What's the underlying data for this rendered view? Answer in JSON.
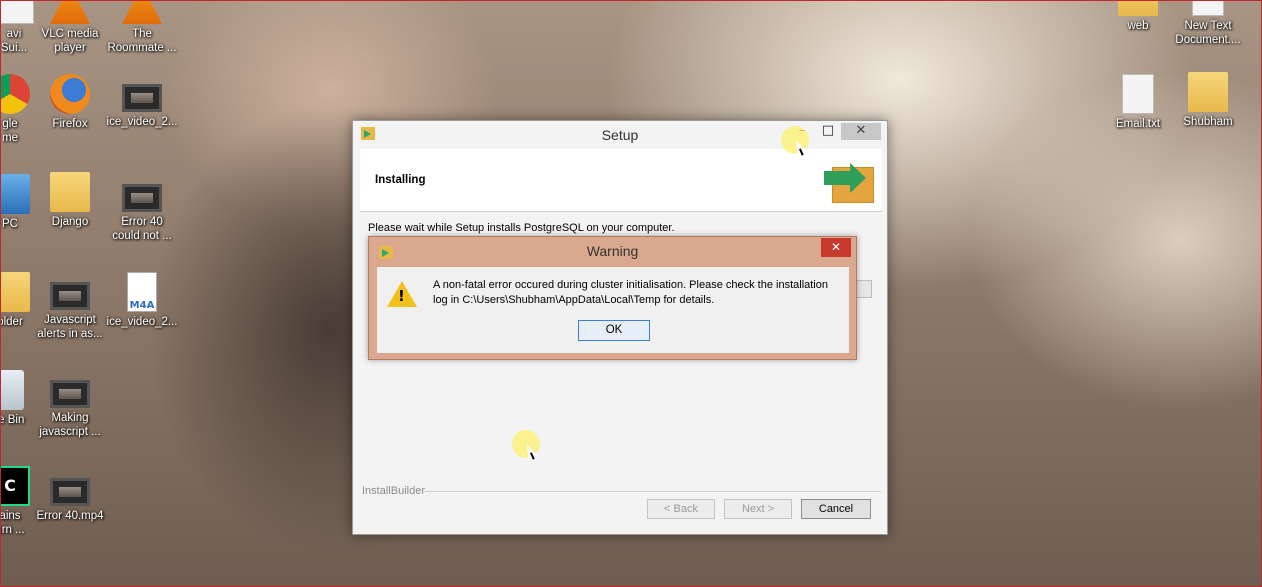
{
  "desktop": {
    "icons_left": [
      {
        "label": "avi\nSui...",
        "icon": "app-icon"
      },
      {
        "label": "VLC media\nplayer",
        "icon": "vlc-icon"
      },
      {
        "label": "The\nRoommate ...",
        "icon": "vlc-icon"
      },
      {
        "label": "gle\nme",
        "icon": "chrome-icon"
      },
      {
        "label": "Firefox",
        "icon": "firefox-icon"
      },
      {
        "label": "ice_video_2...",
        "icon": "video-file-icon"
      },
      {
        "label": "PC",
        "icon": "this-pc-icon"
      },
      {
        "label": "Django",
        "icon": "folder-icon"
      },
      {
        "label": "Error 40\ncould not ...",
        "icon": "video-file-icon"
      },
      {
        "label": "older",
        "icon": "folder-icon"
      },
      {
        "label": "Javascript\nalerts in as...",
        "icon": "video-file-icon"
      },
      {
        "label": "ice_video_2...",
        "icon": "m4a-file-icon"
      },
      {
        "label": "le Bin",
        "icon": "recycle-bin-icon"
      },
      {
        "label": "Making\njavascript ...",
        "icon": "video-file-icon"
      },
      {
        "label": "ains\nurn ...",
        "icon": "jetbrains-icon"
      },
      {
        "label": "Error 40.mp4",
        "icon": "video-file-icon"
      }
    ],
    "icons_right": [
      {
        "label": "web",
        "icon": "folder-icon"
      },
      {
        "label": "New Text\nDocument....",
        "icon": "text-file-icon"
      },
      {
        "label": "Email.txt",
        "icon": "text-file-icon"
      },
      {
        "label": "Shubham",
        "icon": "folder-icon"
      }
    ]
  },
  "setup": {
    "title": "Setup",
    "minimize": "–",
    "maximize": "□",
    "close": "✕",
    "header_title": "Installing",
    "status_text": "Please wait while Setup installs PostgreSQL on your computer.",
    "footer_brand": "InstallBuilder",
    "back_label": "< Back",
    "next_label": "Next >",
    "cancel_label": "Cancel"
  },
  "warning": {
    "title": "Warning",
    "close": "✕",
    "message": "A non-fatal error occured during cluster initialisation. Please check the installation log in C:\\Users\\Shubham\\AppData\\Local\\Temp for details.",
    "ok_label": "OK"
  },
  "colors": {
    "warning_frame": "#d9a88f",
    "close_red": "#c7392c",
    "ok_focus": "#3c7fd8"
  }
}
